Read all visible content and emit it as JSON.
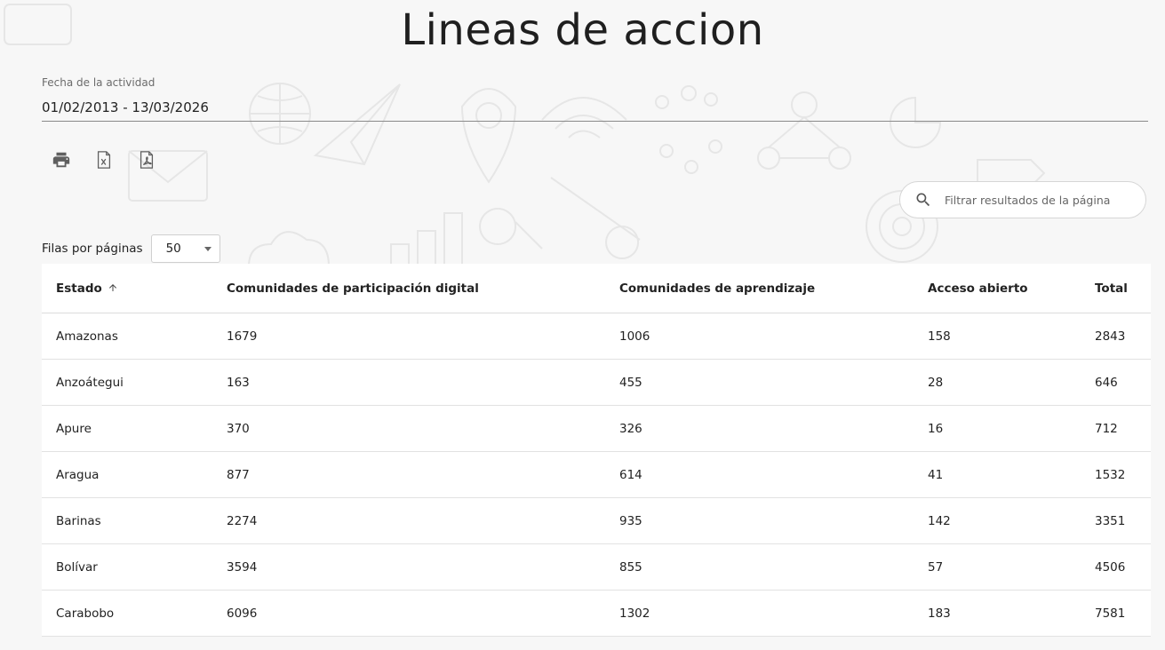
{
  "page": {
    "title": "Lineas de accion"
  },
  "date_filter": {
    "label": "Fecha de la actividad",
    "value": "01/02/2013 - 13/03/2026"
  },
  "export_icons": [
    "print-icon",
    "excel-file-icon",
    "pdf-file-icon"
  ],
  "search": {
    "placeholder": "Filtrar resultados de la página",
    "icon": "search-icon"
  },
  "rows_per_page": {
    "label": "Filas por páginas",
    "value": "50"
  },
  "table": {
    "headers": [
      "Estado",
      "Comunidades de participación digital",
      "Comunidades de aprendizaje",
      "Acceso abierto",
      "Total"
    ],
    "sorted_column": "Estado",
    "sort_direction": "ascending",
    "rows": [
      [
        "Amazonas",
        "1679",
        "1006",
        "158",
        "2843"
      ],
      [
        "Anzoátegui",
        "163",
        "455",
        "28",
        "646"
      ],
      [
        "Apure",
        "370",
        "326",
        "16",
        "712"
      ],
      [
        "Aragua",
        "877",
        "614",
        "41",
        "1532"
      ],
      [
        "Barinas",
        "2274",
        "935",
        "142",
        "3351"
      ],
      [
        "Bolívar",
        "3594",
        "855",
        "57",
        "4506"
      ],
      [
        "Carabobo",
        "6096",
        "1302",
        "183",
        "7581"
      ]
    ]
  },
  "colors": {
    "background": "#f7f7f7",
    "text": "#212121",
    "border": "#dcdcdc",
    "icon": "#5f5f5f"
  }
}
